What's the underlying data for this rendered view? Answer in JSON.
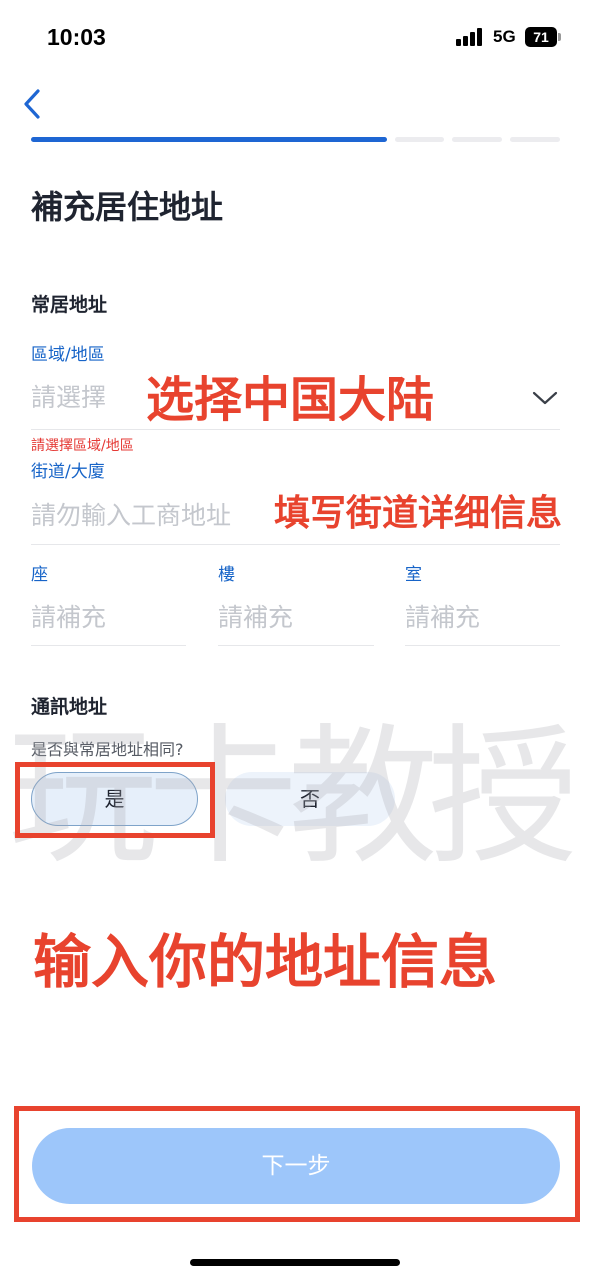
{
  "status_bar": {
    "time": "10:03",
    "network": "5G",
    "battery": "71"
  },
  "header": {
    "back_icon": "chevron-left-icon",
    "progress_steps": 4,
    "current_step": 1
  },
  "page_title": "補充居住地址",
  "residential_address": {
    "section_label": "常居地址",
    "region": {
      "label": "區域/地區",
      "placeholder": "請選擇",
      "error": "請選擇區域/地區",
      "dropdown_icon": "chevron-down-icon"
    },
    "street": {
      "label": "街道/大廈",
      "placeholder": "請勿輸入工商地址"
    },
    "block": {
      "label": "座",
      "placeholder": "請補充"
    },
    "floor": {
      "label": "樓",
      "placeholder": "請補充"
    },
    "room": {
      "label": "室",
      "placeholder": "請補充"
    }
  },
  "mailing_address": {
    "section_label": "通訊地址",
    "question": "是否與常居地址相同?",
    "options": [
      "是",
      "否"
    ],
    "selected": "是"
  },
  "next_button": "下一步",
  "annotations": {
    "region_hint": "选择中国大陆",
    "street_hint": "填写街道详细信息",
    "main_hint": "输入你的地址信息",
    "watermark": "玩卡教授"
  },
  "colors": {
    "accent": "#1e66d3",
    "label_blue": "#1764c8",
    "annotation_red": "#e8432e",
    "button_disabled": "#9dc6fa",
    "error": "#e53935"
  }
}
